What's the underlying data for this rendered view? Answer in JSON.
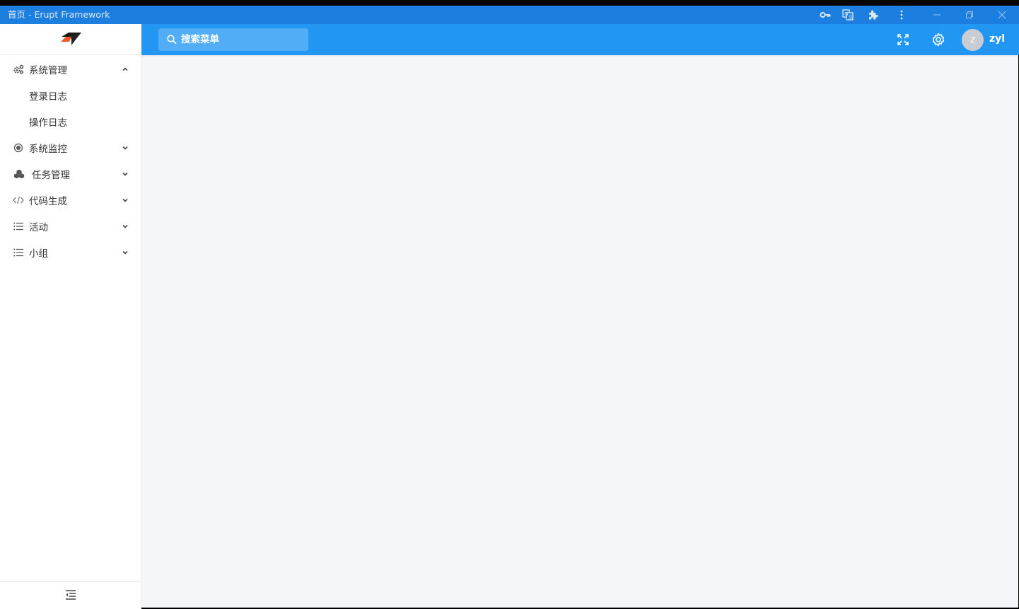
{
  "window": {
    "title": "首页 - Erupt Framework",
    "colors": {
      "titlebar": "#1c7fe0",
      "header": "#2196f3",
      "content_bg": "#f4f6fa"
    },
    "controls": [
      "key-icon",
      "translate-icon",
      "extension-icon",
      "more-vert-icon",
      "minimize-icon",
      "restore-icon",
      "close-icon"
    ]
  },
  "header": {
    "logo": "erupt-logo",
    "search_placeholder": "搜索菜单",
    "fullscreen_icon": "fullscreen-icon",
    "settings_icon": "gear-icon",
    "avatar_letter": "z",
    "username": "zyl"
  },
  "sidebar": {
    "items": [
      {
        "label": "系统管理",
        "icon": "cogs-icon",
        "expanded": true,
        "children": [
          {
            "label": "登录日志"
          },
          {
            "label": "操作日志"
          }
        ]
      },
      {
        "label": "系统监控",
        "icon": "dot-circle-icon",
        "expanded": false
      },
      {
        "label": "任务管理",
        "icon": "cubes-icon",
        "expanded": false
      },
      {
        "label": "代码生成",
        "icon": "code-icon",
        "expanded": false
      },
      {
        "label": "活动",
        "icon": "list-icon",
        "expanded": false
      },
      {
        "label": "小组",
        "icon": "list-icon",
        "expanded": false
      }
    ],
    "collapse_icon": "menu-fold-icon"
  }
}
